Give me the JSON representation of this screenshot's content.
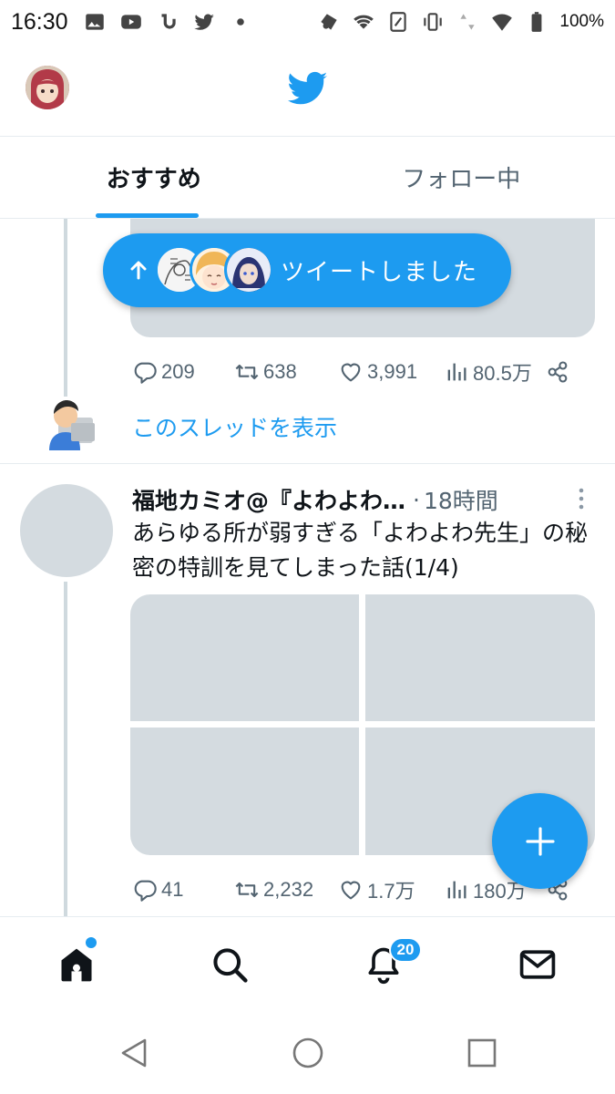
{
  "status_bar": {
    "time": "16:30",
    "battery_percent": "100%",
    "left_icons": [
      "image-icon",
      "youtube-icon",
      "app-icon",
      "twitter-icon",
      "dot-icon"
    ],
    "right_icons": [
      "app-icon",
      "wifi-icon",
      "nfc-icon",
      "vibrate-icon",
      "data-icon",
      "signal-icon",
      "battery-icon"
    ]
  },
  "header": {
    "avatar": "avatar",
    "logo": "twitter-bird-icon"
  },
  "tabs": [
    {
      "label": "おすすめ",
      "active": true
    },
    {
      "label": "フォロー中",
      "active": false
    }
  ],
  "new_tweets_pill": {
    "label": "ツイートしました"
  },
  "tweet1": {
    "stats": {
      "replies": "209",
      "retweets": "638",
      "likes": "3,991",
      "views": "80.5万"
    },
    "show_thread": "このスレッドを表示"
  },
  "tweet2": {
    "author": "福地カミオ@『よわよわ…",
    "separator": "·",
    "time": "18時間",
    "text": "あらゆる所が弱すぎる「よわよわ先生」の秘密の特訓を見てしまった話(1/4)",
    "stats": {
      "replies": "41",
      "retweets": "2,232",
      "likes": "1.7万",
      "views": "180万"
    }
  },
  "bottom_nav": {
    "items": [
      "home-icon",
      "search-icon",
      "notifications-icon",
      "messages-icon"
    ],
    "notification_badge": "20"
  },
  "colors": {
    "accent": "#1d9bf0",
    "text": "#0f1419",
    "secondary": "#536471",
    "placeholder": "#d4dbe0"
  }
}
